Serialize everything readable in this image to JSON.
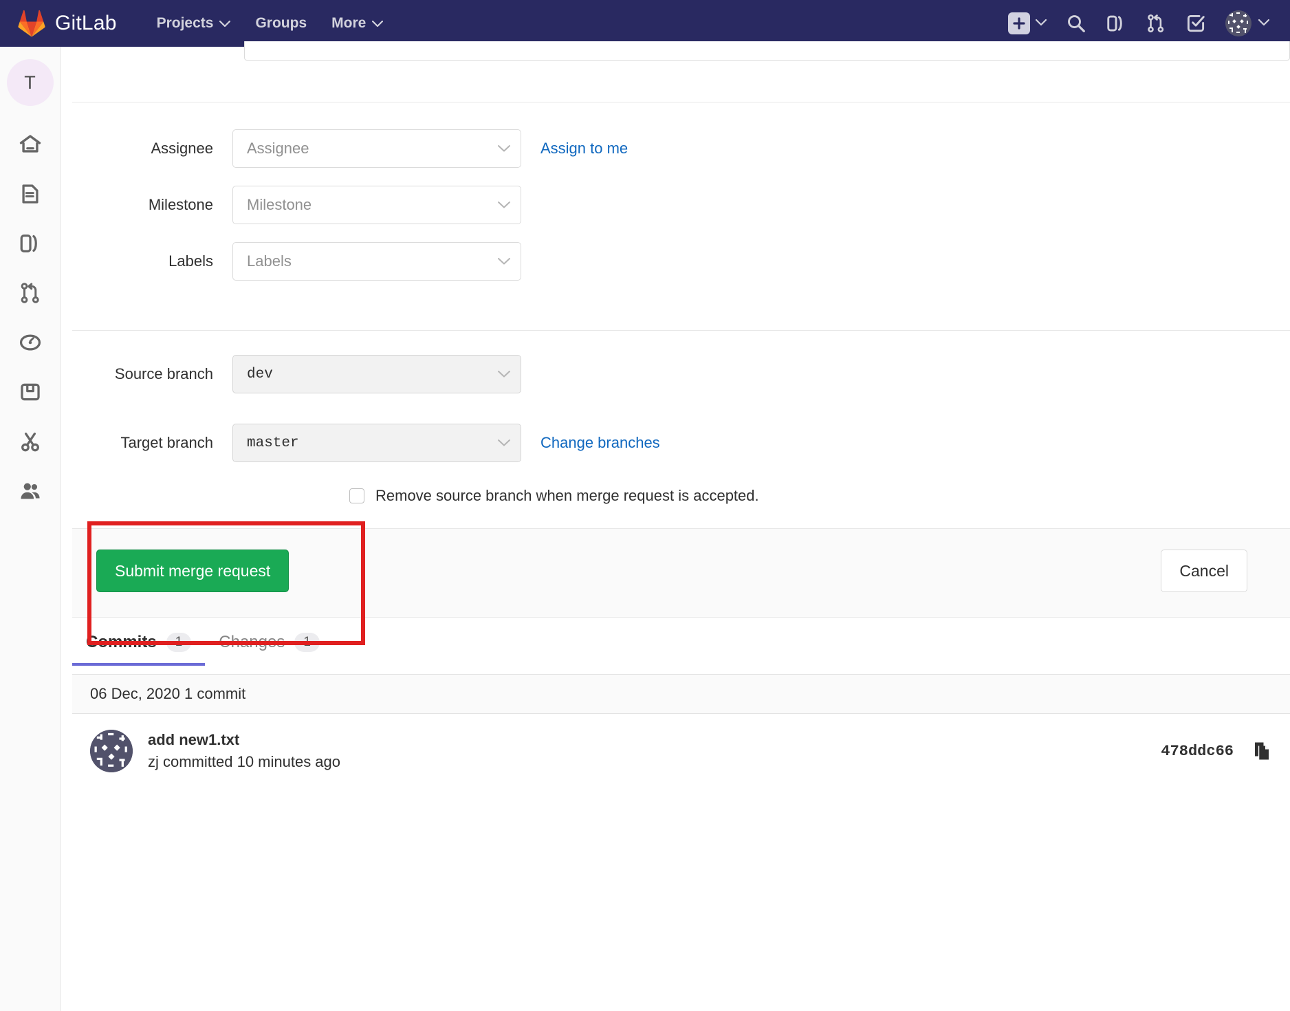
{
  "navbar": {
    "brand": "GitLab",
    "links": [
      {
        "label": "Projects",
        "has_chevron": true
      },
      {
        "label": "Groups",
        "has_chevron": false
      },
      {
        "label": "More",
        "has_chevron": true
      }
    ],
    "icons": [
      "plus-square-icon",
      "search-icon",
      "issues-icon",
      "merge-requests-icon",
      "todos-icon",
      "user-avatar"
    ],
    "background_color": "#292961"
  },
  "sidebar": {
    "project_initial": "T",
    "items": [
      {
        "name": "home-icon",
        "label": "Project overview"
      },
      {
        "name": "file-document-icon",
        "label": "Repository"
      },
      {
        "name": "issues-icon",
        "label": "Issues"
      },
      {
        "name": "merge-requests-icon",
        "label": "Merge Requests"
      },
      {
        "name": "pipelines-icon",
        "label": "CI / CD"
      },
      {
        "name": "package-icon",
        "label": "Packages"
      },
      {
        "name": "snippets-icon",
        "label": "Snippets"
      },
      {
        "name": "members-icon",
        "label": "Members"
      }
    ]
  },
  "form": {
    "assignee": {
      "label": "Assignee",
      "value": "Assignee",
      "link": "Assign to me"
    },
    "milestone": {
      "label": "Milestone",
      "value": "Milestone"
    },
    "labels": {
      "label": "Labels",
      "value": "Labels"
    },
    "source_branch": {
      "label": "Source branch",
      "value": "dev"
    },
    "target_branch": {
      "label": "Target branch",
      "value": "master",
      "link": "Change branches"
    },
    "remove_source_branch": {
      "label": "Remove source branch when merge request is accepted.",
      "checked": false
    }
  },
  "actions": {
    "submit_label": "Submit merge request",
    "cancel_label": "Cancel",
    "submit_color": "#1aaa55",
    "highlight_color": "#e02020"
  },
  "tabs": [
    {
      "label": "Commits",
      "count": "1",
      "active": true
    },
    {
      "label": "Changes",
      "count": "1",
      "active": false
    }
  ],
  "commits": {
    "group_header": "06 Dec, 2020 1 commit",
    "items": [
      {
        "title": "add new1.txt",
        "meta": "zj committed 10 minutes ago",
        "sha": "478ddc66",
        "copy_icon": "copy-icon"
      }
    ]
  }
}
